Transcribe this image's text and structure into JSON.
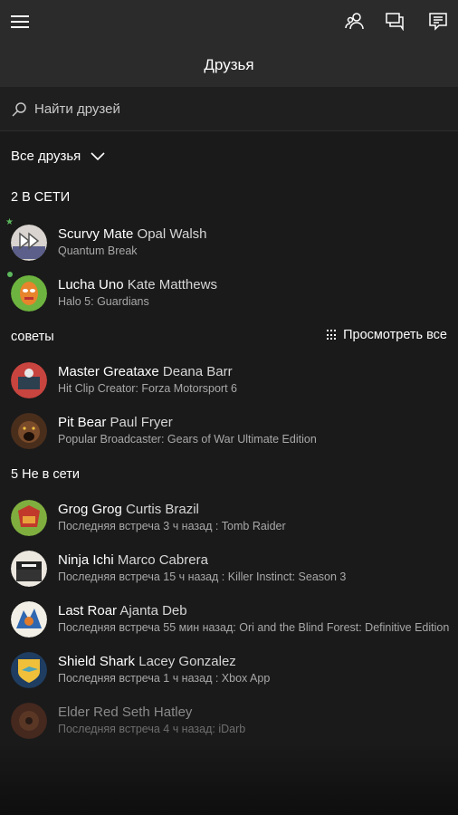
{
  "header": {
    "title": "Друзья"
  },
  "search": {
    "placeholder": "Найти друзей"
  },
  "filter": {
    "label": "Все друзья"
  },
  "sections": {
    "online": "2 В СЕТИ",
    "suggestions": "советы",
    "view_all": "Просмотреть все",
    "offline": "5 Не в сети"
  },
  "online_friends": [
    {
      "gamertag": "Scurvy Mate",
      "name": "Opal Walsh",
      "status": "Quantum Break"
    },
    {
      "gamertag": "Lucha Uno",
      "name": "Kate Matthews",
      "status": "Halo 5: Guardians"
    }
  ],
  "suggestions": [
    {
      "gamertag": "Master Greataxe",
      "name": "Deana Barr",
      "status": "Hit Clip Creator: Forza Motorsport 6"
    },
    {
      "gamertag": "Pit Bear",
      "name": "Paul Fryer",
      "status": "Popular Broadcaster: Gears of War Ultimate Edition"
    }
  ],
  "offline_friends": [
    {
      "gamertag": "Grog Grog",
      "name": "Curtis Brazil",
      "status": "Последняя встреча 3 ч назад : Tomb Raider"
    },
    {
      "gamertag": "Ninja Ichi",
      "name": "Marco Cabrera",
      "status": "Последняя встреча 15 ч назад : Killer Instinct: Season 3"
    },
    {
      "gamertag": "Last Roar",
      "name": "Ajanta Deb",
      "status": "Последняя встреча 55 мин назад: Ori and the Blind Forest: Definitive Edition"
    },
    {
      "gamertag": "Shield Shark",
      "name": "Lacey Gonzalez",
      "status": "Последняя встреча 1 ч назад : Xbox App"
    },
    {
      "gamertag": "Elder Red",
      "name": "Seth Hatley",
      "status": "Последняя встреча 4 ч назад: iDarb"
    }
  ],
  "colors": {
    "online": "#5cb85c",
    "header_bg": "#2b2b2b",
    "page_bg": "#1a1a1a"
  },
  "icons": [
    "hamburger-icon",
    "friends-icon",
    "messages-icon",
    "activity-feed-icon",
    "search-icon",
    "chevron-down-icon",
    "grid-icon"
  ]
}
